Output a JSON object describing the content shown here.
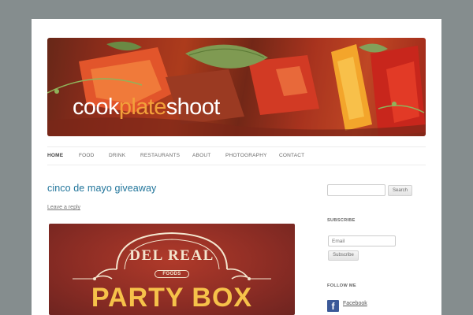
{
  "site": {
    "logo": {
      "part1": "cook",
      "part2": "plate",
      "part3": "shoot"
    }
  },
  "nav": {
    "items": [
      {
        "label": "HOME",
        "active": true
      },
      {
        "label": "FOOD",
        "active": false
      },
      {
        "label": "DRINK",
        "active": false
      },
      {
        "label": "RESTAURANTS",
        "active": false
      },
      {
        "label": "ABOUT",
        "active": false
      },
      {
        "label": "PHOTOGRAPHY",
        "active": false
      },
      {
        "label": "CONTACT",
        "active": false
      }
    ]
  },
  "post": {
    "title": "cinco de mayo giveaway",
    "reply_link": "Leave a reply",
    "image": {
      "brand": "DEL REAL",
      "brand_sub": "FOODS",
      "headline": "PARTY BOX"
    }
  },
  "sidebar": {
    "search": {
      "placeholder": "",
      "button_label": "Search"
    },
    "subscribe": {
      "title": "SUBSCRIBE",
      "email_placeholder": "Email",
      "button_label": "Subscribe"
    },
    "follow": {
      "title": "FOLLOW ME",
      "facebook_label": "Facebook",
      "facebook_icon": "facebook-icon",
      "twitter_icon": "twitter-icon"
    }
  },
  "colors": {
    "background": "#858d8e",
    "link_blue": "#21759b",
    "logo_accent": "#f2a03a",
    "facebook": "#3b5998",
    "twitter": "#4aa7d8"
  }
}
